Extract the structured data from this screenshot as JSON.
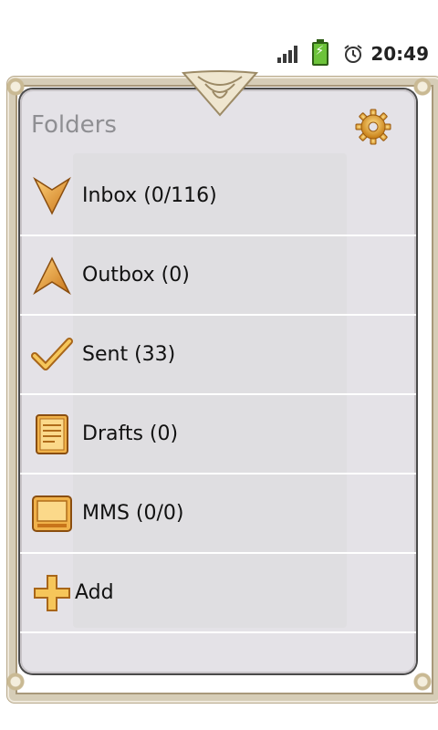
{
  "status_bar": {
    "time": "20:49",
    "icons": [
      "signal-icon",
      "battery-icon",
      "alarm-icon"
    ]
  },
  "header": {
    "title": "Folders",
    "settings_icon": "gear-icon"
  },
  "folders": [
    {
      "label": "Inbox (0/116)",
      "icon": "inbox-icon"
    },
    {
      "label": "Outbox (0)",
      "icon": "outbox-icon"
    },
    {
      "label": "Sent (33)",
      "icon": "sent-icon"
    },
    {
      "label": "Drafts (0)",
      "icon": "drafts-icon"
    },
    {
      "label": "MMS (0/0)",
      "icon": "mms-icon"
    },
    {
      "label": "Add",
      "icon": "add-icon"
    }
  ],
  "colors": {
    "panel": "#e4e2e7",
    "gold": "#e2a23a",
    "gold_dark": "#a8661a"
  }
}
